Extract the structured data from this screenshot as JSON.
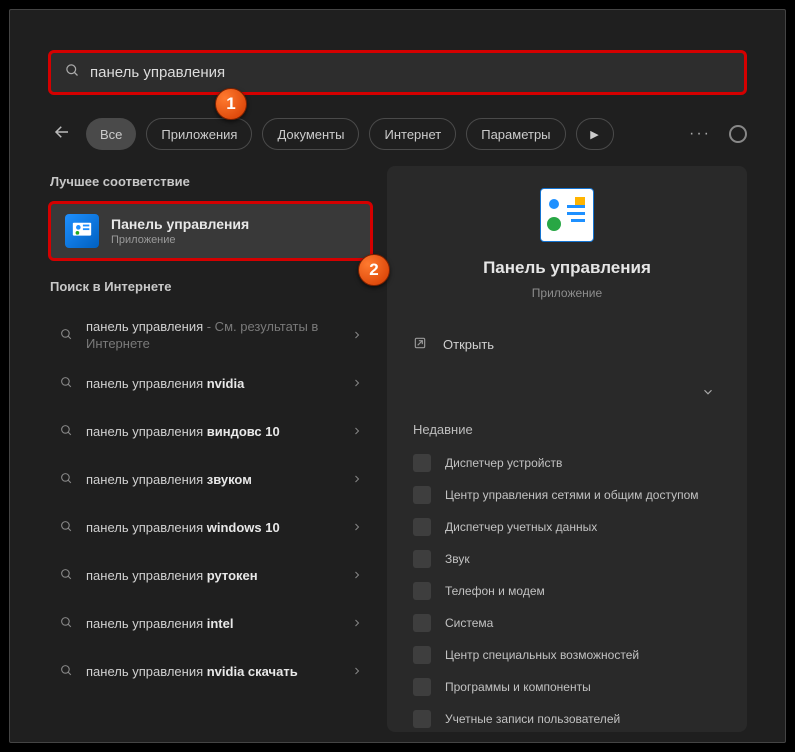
{
  "search": {
    "value": "панель управления"
  },
  "callouts": {
    "c1": "1",
    "c2": "2"
  },
  "filters": {
    "all": "Все",
    "apps": "Приложения",
    "docs": "Документы",
    "web": "Интернет",
    "settings": "Параметры"
  },
  "left": {
    "best_label": "Лучшее соответствие",
    "best_title": "Панель управления",
    "best_sub": "Приложение",
    "web_label": "Поиск в Интернете",
    "web_items": [
      {
        "prefix": "панель управления",
        "bold": "",
        "suffix": " - См. результаты в Интернете"
      },
      {
        "prefix": "панель управления ",
        "bold": "nvidia",
        "suffix": ""
      },
      {
        "prefix": "панель управления ",
        "bold": "виндовс 10",
        "suffix": ""
      },
      {
        "prefix": "панель управления ",
        "bold": "звуком",
        "suffix": ""
      },
      {
        "prefix": "панель управления ",
        "bold": "windows 10",
        "suffix": ""
      },
      {
        "prefix": "панель управления ",
        "bold": "рутокен",
        "suffix": ""
      },
      {
        "prefix": "панель управления ",
        "bold": "intel",
        "suffix": ""
      },
      {
        "prefix": "панель управления ",
        "bold": "nvidia скачать",
        "suffix": ""
      }
    ]
  },
  "right": {
    "title": "Панель управления",
    "sub": "Приложение",
    "open": "Открыть",
    "recent_label": "Недавние",
    "recent": [
      "Диспетчер устройств",
      "Центр управления сетями и общим доступом",
      "Диспетчер учетных данных",
      "Звук",
      "Телефон и модем",
      "Система",
      "Центр специальных возможностей",
      "Программы и компоненты",
      "Учетные записи пользователей"
    ]
  }
}
